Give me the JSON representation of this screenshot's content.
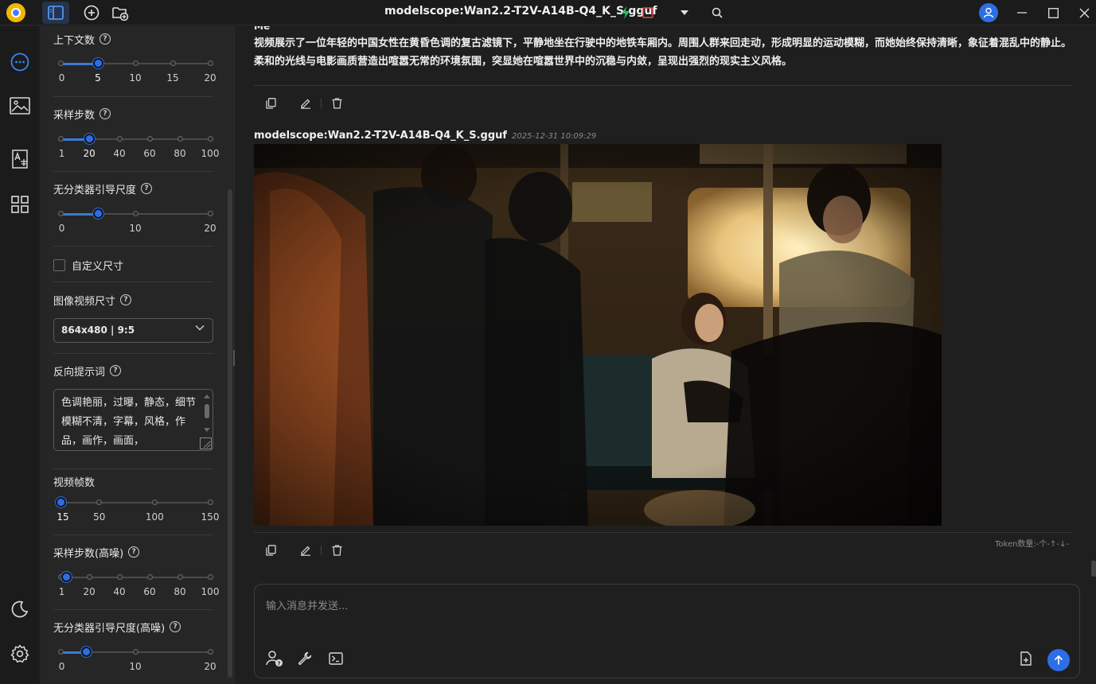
{
  "window": {
    "title": "modelscope:Wan2.2-T2V-A14B-Q4_K_S.gguf"
  },
  "settings": {
    "context": {
      "label": "上下文数",
      "marks": [
        "0",
        "5",
        "10",
        "15",
        "20"
      ],
      "min": 0,
      "max": 20,
      "value": 5
    },
    "steps": {
      "label": "采样步数",
      "marks": [
        "1",
        "20",
        "40",
        "60",
        "80",
        "100"
      ],
      "min": 1,
      "max": 100,
      "value": 20
    },
    "cfg": {
      "label": "无分类器引导尺度",
      "marks": [
        "0",
        "10",
        "20"
      ],
      "min": 0,
      "max": 20,
      "value": 5
    },
    "custom_size": {
      "label": "自定义尺寸",
      "checked": false
    },
    "image_video_size": {
      "label": "图像视频尺寸",
      "value": "864x480 | 9:5"
    },
    "negative_prompt": {
      "label": "反向提示词",
      "value": "色调艳丽，过曝，静态，细节模糊不清，字幕，风格，作品，画作，画面，"
    },
    "video_frames": {
      "label": "视频帧数",
      "marks": [
        "15",
        "50",
        "100",
        "150"
      ],
      "min": 15,
      "max": 150,
      "value": 15
    },
    "steps_high": {
      "label": "采样步数(高噪)",
      "marks": [
        "1",
        "20",
        "40",
        "60",
        "80",
        "100"
      ],
      "min": 1,
      "max": 100,
      "value": 5
    },
    "cfg_high": {
      "label": "无分类器引导尺度(高噪)",
      "marks": [
        "0",
        "10",
        "20"
      ],
      "min": 0,
      "max": 20,
      "value": 3.5
    }
  },
  "chat": {
    "user_sender": "Me",
    "user_message": "视频展示了一位年轻的中国女性在黄昏色调的复古滤镜下，平静地坐在行驶中的地铁车厢内。周围人群来回走动，形成明显的运动模糊，而她始终保持清晰，象征着混乱中的静止。柔和的光线与电影画质营造出喧嚣无常的环境氛围，突显她在喧嚣世界中的沉稳与内敛，呈现出强烈的现实主义风格。",
    "ai_sender": "modelscope:Wan2.2-T2V-A14B-Q4_K_S.gguf",
    "ai_timestamp": "2025-12-31 10:09:29",
    "token_info": "Token数量:-个-↑-↓-",
    "input_placeholder": "输入消息并发送..."
  },
  "colors": {
    "accent": "#2d6ee6",
    "bg": "#1f1f1f",
    "panel": "#262626"
  }
}
